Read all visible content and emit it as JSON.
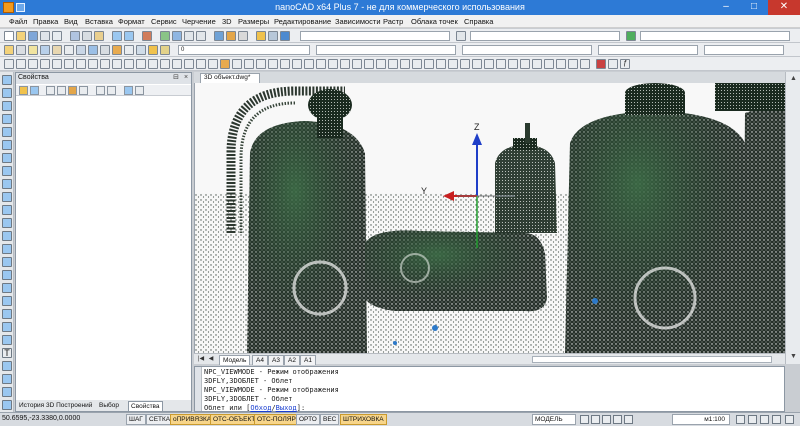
{
  "window": {
    "title": "nanoCAD x64 Plus 7 - не для коммерческого использования",
    "minimize": "–",
    "maximize": "□",
    "close": "✕"
  },
  "menu": [
    "Файл",
    "Правка",
    "Вид",
    "Вставка",
    "Формат",
    "Сервис",
    "Черчение",
    "3D",
    "Размеры",
    "Редактирование",
    "Зависимости",
    "Растр",
    "Облака точек",
    "Справка"
  ],
  "toolbar": {
    "layer_value": "0",
    "annotation_scale": "1:1"
  },
  "properties_panel": {
    "title": "Свойства",
    "pin": "⊟",
    "close": "×",
    "tabs": [
      "История 3D Построений",
      "Выбор",
      "Свойства"
    ],
    "active_tab": "Свойства"
  },
  "document": {
    "tab_label": "3D объект.dwg*",
    "layout_tabs": [
      "Модель",
      "A4",
      "A3",
      "A2",
      "A1"
    ],
    "active_layout": "Модель"
  },
  "viewport": {
    "axis_z": "Z",
    "axis_y": "Y"
  },
  "command_line": {
    "lines": [
      "NPC_VIEWMODE - Режим отображения",
      "3DFLY,3DОБЛЕТ - Облет",
      "NPC_VIEWMODE - Режим отображения",
      "3DFLY,3DОБЛЕТ - Облет"
    ],
    "prompt_prefix": "Облет или [",
    "prompt_opt1": "Обход",
    "prompt_sep": "/",
    "prompt_opt2": "Выход",
    "prompt_suffix": "]:"
  },
  "status": {
    "coords": "50.6595,-23.3380,0.0000",
    "buttons": [
      "ШАГ",
      "СЕТКА",
      "оПРИВЯЗКА",
      "ОТС-ОБЪЕКТ",
      "ОТС-ПОЛЯР",
      "ОРТО",
      "ВЕС",
      "ШТРИХОВКА"
    ],
    "active_buttons": [
      "оПРИВЯЗКА",
      "ОТС-ОБЪЕКТ",
      "ОТС-ПОЛЯР",
      "ШТРИХОВКА"
    ],
    "space": "МОДЕЛЬ",
    "scale": "м1:100"
  },
  "colors": {
    "titlebar": "#2d7ad6",
    "active_status": "#f7d58a",
    "point_cloud": "#15201a",
    "point_cloud_green": "#1f4a2a"
  }
}
